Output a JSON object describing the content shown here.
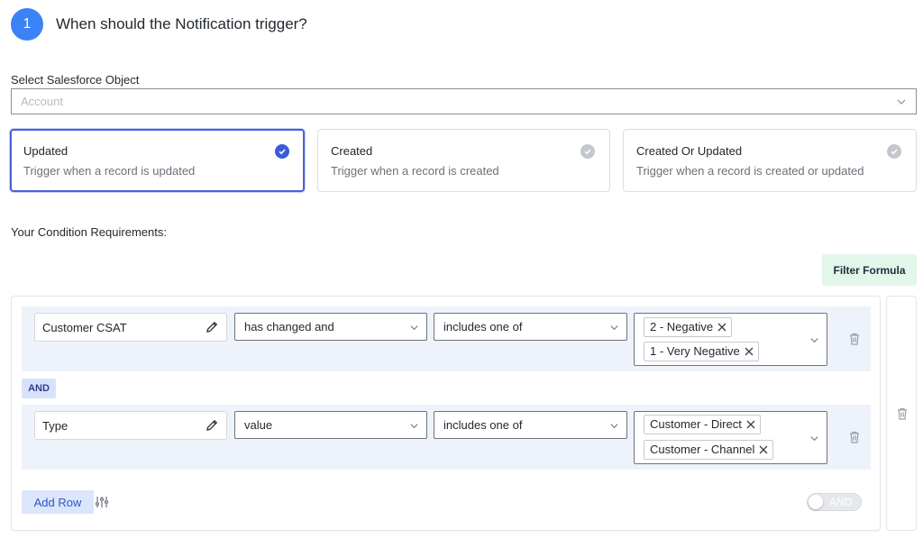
{
  "header": {
    "step_number": "1",
    "title": "When should the Notification trigger?"
  },
  "object": {
    "label": "Select Salesforce Object",
    "placeholder": "Account"
  },
  "triggers": [
    {
      "title": "Updated",
      "description": "Trigger when a record is updated",
      "selected": true
    },
    {
      "title": "Created",
      "description": "Trigger when a record is created",
      "selected": false
    },
    {
      "title": "Created Or Updated",
      "description": "Trigger when a record is created or updated",
      "selected": false
    }
  ],
  "conditions": {
    "heading": "Your Condition Requirements:",
    "filter_formula_label": "Filter Formula",
    "rows": [
      {
        "field": "Customer CSAT",
        "change": "has changed and",
        "operator": "includes one of",
        "values": [
          "2 - Negative",
          "1 - Very Negative"
        ]
      },
      {
        "field": "Type",
        "change": "value",
        "operator": "includes one of",
        "values": [
          "Customer - Direct",
          "Customer - Channel"
        ]
      }
    ],
    "joiner": "AND",
    "add_row_label": "Add Row",
    "toggle_label": "AND"
  },
  "colors": {
    "accent": "#3b82f6",
    "selected_border": "#4a61d6",
    "row_bg": "#eef2fb",
    "filter_bg": "#e3f6ea"
  }
}
